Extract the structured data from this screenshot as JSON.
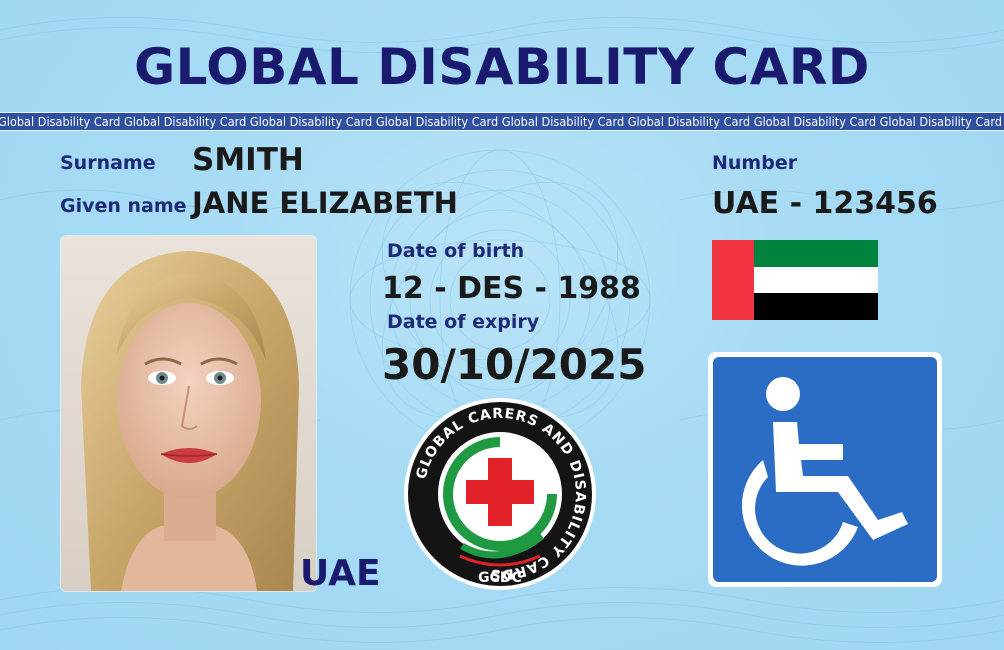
{
  "card": {
    "title": "GLOBAL DISABILITY CARD",
    "microprint": "Global Disability Card",
    "surname_label": "Surname",
    "surname": "SMITH",
    "given_name_label": "Given name",
    "given_name": "JANE ELIZABETH",
    "number_label": "Number",
    "number": "UAE - 123456",
    "dob_label": "Date of birth",
    "dob": "12 - DES - 1988",
    "expiry_label": "Date of expiry",
    "expiry": "30/10/2025",
    "country": "UAE",
    "seal": {
      "ring_text": "GLOBAL CARERS AND DISABILITY CARDS",
      "abbr": "GCDC"
    },
    "colors": {
      "title": "#1a1a6e",
      "label": "#1e2a78",
      "sign_blue": "#2b6cc4",
      "flag_red": "#ef3340",
      "flag_green": "#00843d",
      "flag_black": "#000000",
      "seal_green": "#1f9a43",
      "seal_red": "#e32128"
    },
    "icons": [
      "uae-flag-icon",
      "wheelchair-icon",
      "medical-cross-icon",
      "caring-hand-icon"
    ]
  }
}
